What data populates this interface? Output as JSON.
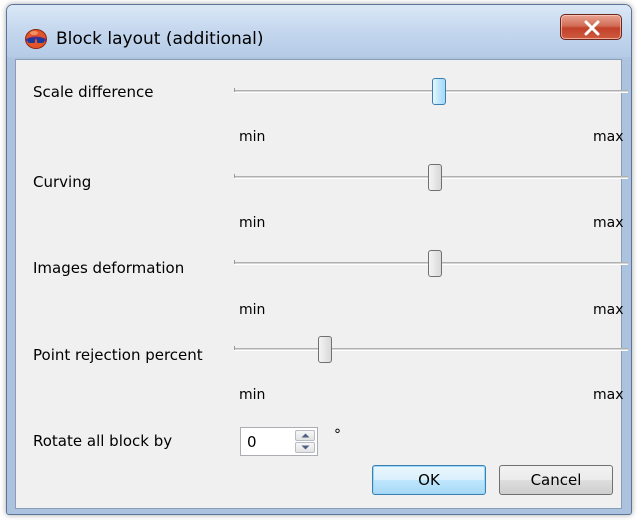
{
  "window": {
    "title": "Block layout (additional)",
    "icon": "app-logo-icon",
    "close_icon": "close-icon"
  },
  "sliders": [
    {
      "label": "Scale difference",
      "min_label": "min",
      "max_label": "max",
      "level": 0.52,
      "focused": true
    },
    {
      "label": "Curving",
      "min_label": "min",
      "max_label": "max",
      "level": 0.51,
      "focused": false
    },
    {
      "label": "Images deformation",
      "min_label": "min",
      "max_label": "max",
      "level": 0.51,
      "focused": false
    },
    {
      "label": "Point rejection percent",
      "min_label": "min",
      "max_label": "max",
      "level": 0.22,
      "focused": false
    }
  ],
  "rotate": {
    "label": "Rotate all block by",
    "value": "0",
    "unit": "°"
  },
  "buttons": {
    "ok_label": "OK",
    "cancel_label": "Cancel"
  },
  "colors": {
    "focus_blue": "#3c7fb1",
    "close_red": "#c2412a",
    "dialog_bg": "#f0f0f0"
  }
}
